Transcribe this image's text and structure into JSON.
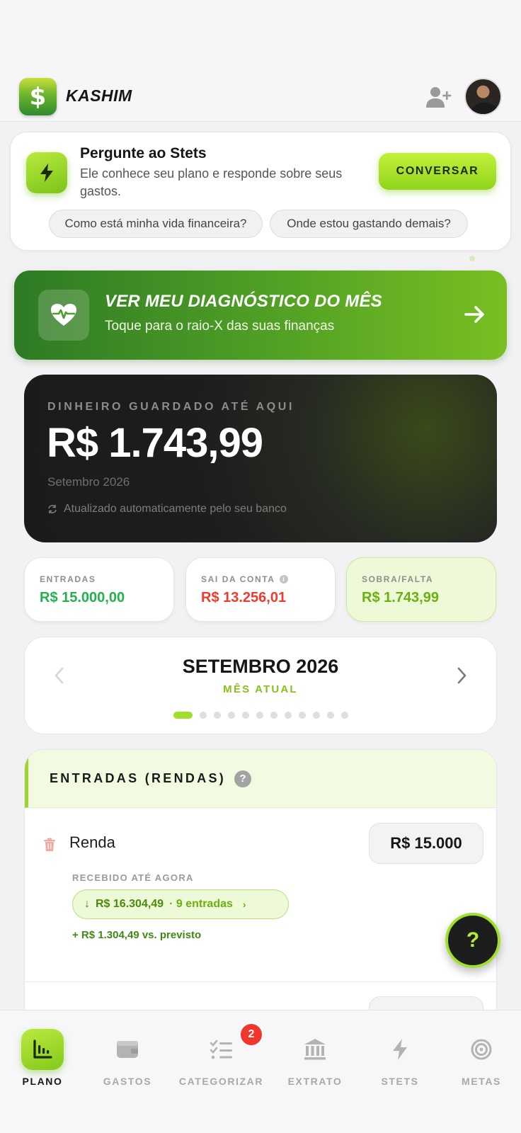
{
  "header": {
    "brand": "KASHIM",
    "logo_symbol": "$"
  },
  "ask": {
    "title": "Pergunte ao Stets",
    "subtitle": "Ele conhece seu plano e responde sobre seus gastos.",
    "button": "CONVERSAR",
    "chips": [
      "Como está minha vida financeira?",
      "Onde estou gastando demais?"
    ]
  },
  "diagnostic": {
    "title": "VER MEU DIAGNÓSTICO DO MÊS",
    "subtitle": "Toque para o raio-X das suas finanças"
  },
  "savings": {
    "label": "DINHEIRO GUARDADO ATÉ AQUI",
    "value": "R$ 1.743,99",
    "month": "Setembro 2026",
    "sync_note": "Atualizado automaticamente pelo seu banco"
  },
  "stats": [
    {
      "label": "ENTRADAS",
      "value": "R$ 15.000,00",
      "color": "#22b14c"
    },
    {
      "label": "SAI DA CONTA",
      "value": "R$ 13.256,01",
      "color": "#ef3b2e"
    },
    {
      "label": "SOBRA/FALTA",
      "value": "R$ 1.743,99",
      "color": "#6caf10"
    }
  ],
  "month_selector": {
    "title": "SETEMBRO 2026",
    "subtitle": "MÊS ATUAL",
    "active_index": 0,
    "dot_count": 12
  },
  "income": {
    "title": "ENTRADAS (RENDAS)",
    "help": "?",
    "row": {
      "label": "Renda",
      "value": "R$ 15.000",
      "received_label": "RECEBIDO ATÉ AGORA",
      "received_value": "R$ 16.304,49",
      "received_count": "· 9 entradas",
      "diff": "+ R$ 1.304,49 vs. previsto"
    }
  },
  "help_fab": "?",
  "nav": {
    "items": [
      {
        "label": "PLANO",
        "icon": "chart-icon",
        "active": true
      },
      {
        "label": "GASTOS",
        "icon": "wallet-icon",
        "active": false
      },
      {
        "label": "CATEGORIZAR",
        "icon": "checklist-icon",
        "active": false
      },
      {
        "label": "EXTRATO",
        "icon": "bank-icon",
        "active": false
      },
      {
        "label": "STETS",
        "icon": "bolt-icon",
        "active": false
      },
      {
        "label": "METAS",
        "icon": "target-icon",
        "active": false
      }
    ],
    "badge": "2"
  },
  "colors": {
    "accent": "#9ee02a",
    "brand_green": "#4f9e25",
    "dark_card": "#1d1d1d"
  }
}
